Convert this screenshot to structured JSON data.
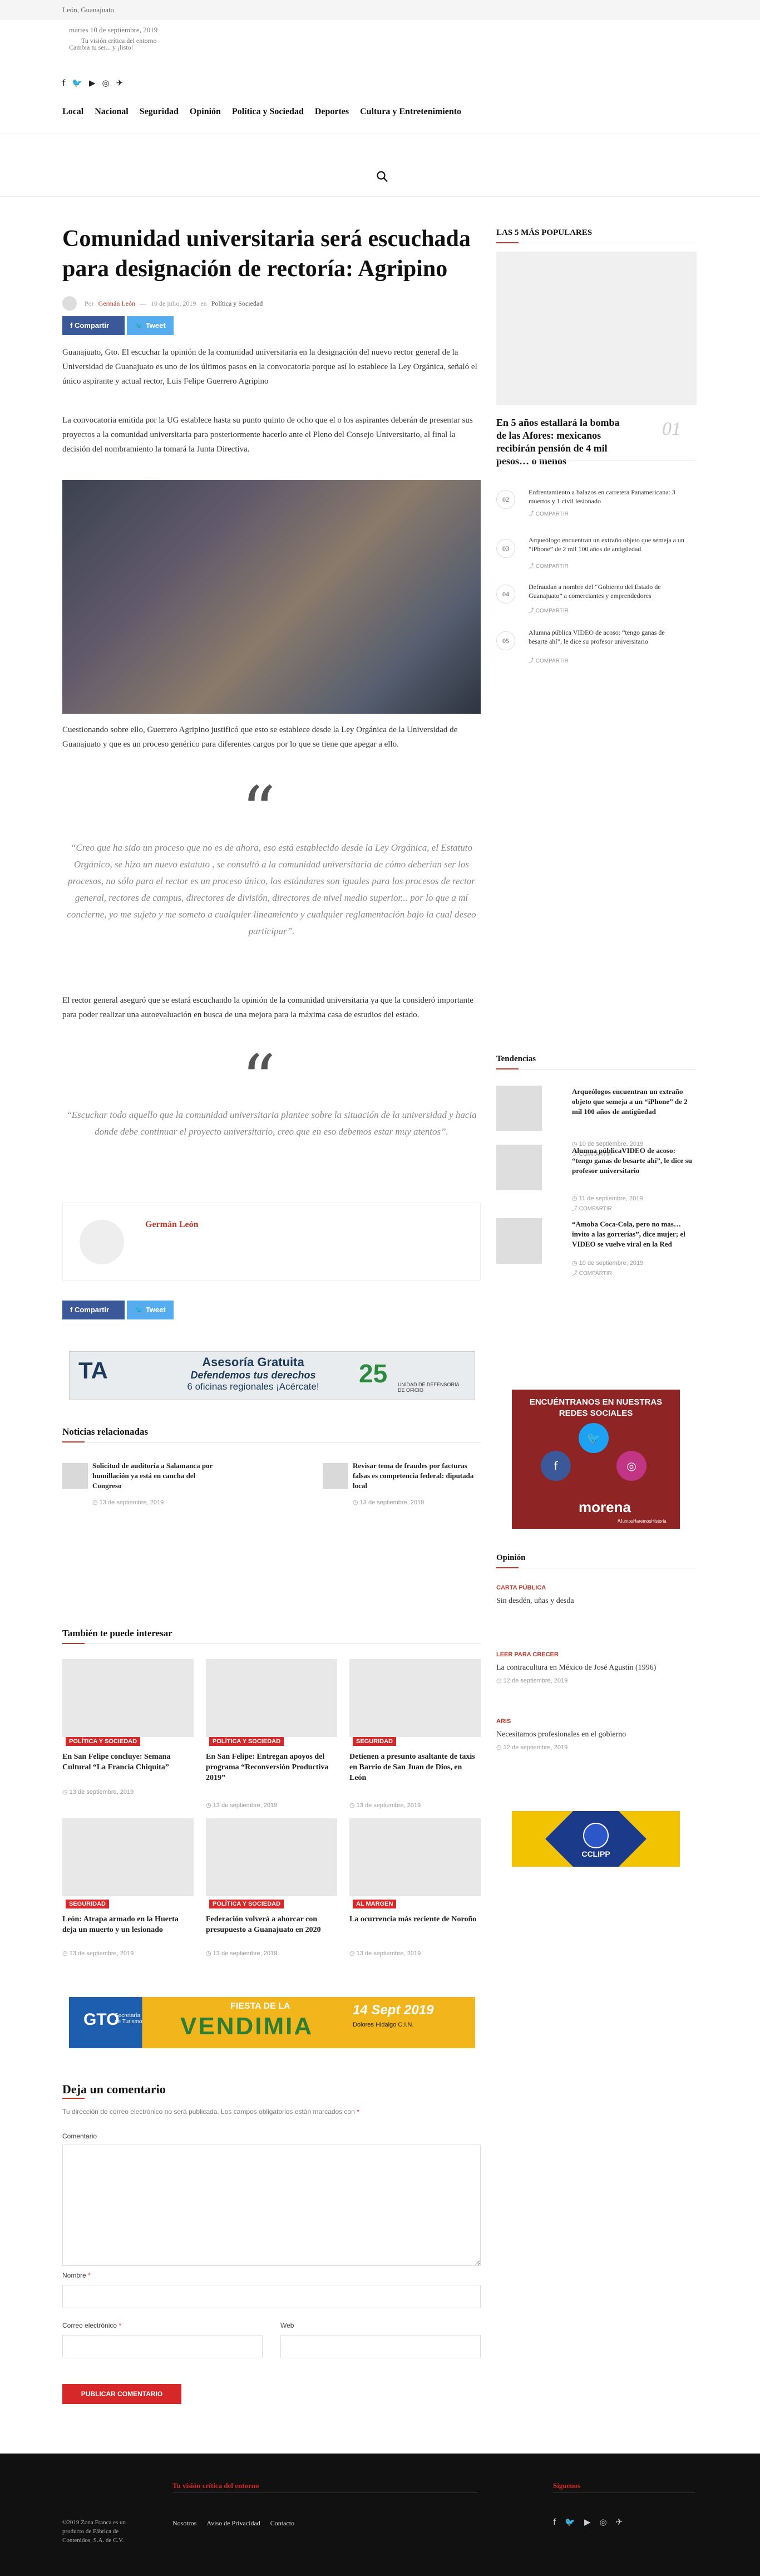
{
  "topbar": {
    "location": "León, Guanajuato"
  },
  "header": {
    "date": "martes 10 de septiembre, 2019",
    "logo_line1": "Tu visión crítica del entorno",
    "logo_line2": "Cambia tu ser... y ¡listo!",
    "social_icons": [
      "facebook-icon",
      "twitter-icon",
      "youtube-icon",
      "instagram-icon",
      "telegram-icon"
    ],
    "nav": [
      "Local",
      "Nacional",
      "Seguridad",
      "Opinión",
      "Política y Sociedad",
      "Deportes",
      "Cultura y Entretenimiento"
    ]
  },
  "article": {
    "title": "Comunidad universitaria será escuchada para designación de rectoría: Agripino",
    "meta": {
      "by": "Por",
      "author": "Germán León",
      "date": "10 de julio, 2019",
      "in": "en",
      "category": "Política y Sociedad"
    },
    "share": {
      "facebook": "Compartir",
      "twitter": "Tweet"
    },
    "p1": "Guanajuato, Gto. El escuchar la opinión de la comunidad universitaria en la designación del nuevo rector general de la Universidad de Guanajuato es uno de los últimos pasos en la convocatoria porque así lo establece la Ley Orgánica, señaló el único aspirante y actual rector, Luis Felipe Guerrero Agripino",
    "p2": "La convocatoria emitida por la UG establece hasta su punto quinto de ocho que el o los aspirantes deberán de presentar sus proyectos a la comunidad universitaria para posteriormente hacerlo ante el Pleno del Consejo Universitario, al final la decisión del nombramiento la tomará la Junta Directiva.",
    "p3": "Cuestionando sobre ello, Guerrero Agripino justificó que esto se establece desde la Ley Orgánica de la Universidad de Guanajuato y que es un proceso genérico para diferentes cargos por lo que se tiene que apegar a ello.",
    "quote1": "“Creo que ha sido un proceso que no es de ahora, eso está establecido desde la Ley Orgánica, el Estatuto Orgánico, se hizo un nuevo estatuto , se consultó a la comunidad universitaria de cómo deberían ser los procesos, no sólo para el rector es un proceso único, los estándares son iguales para los procesos de rector general, rectores de campus, directores de división, directores de nivel medio superior... por lo que a mí concierne, yo me sujeto y me someto a cualquier lineamiento y cualquier reglamentación bajo la cual deseo participar”.",
    "p4": "El rector general aseguró que se estará escuchando la opinión de la comunidad universitaria ya que la consideró importante para poder realizar una autoevaluación en busca de una mejora para la máxima casa de estudios del estado.",
    "quote2": "“Escuchar todo aquello que la comunidad universitaria plantee sobre la situación de la universidad y hacia donde debe continuar el proyecto universitario, creo que en eso debemos estar muy atentos”.",
    "author_box": "Germán León"
  },
  "ad1": {
    "title": "Asesoría Gratuita",
    "line2": "Defendemos tus derechos",
    "line3": "6 oficinas regionales ¡Acércate!",
    "years": "25",
    "unit": "UNIDAD DE DEFENSORÍA DE OFICIO"
  },
  "related": {
    "heading": "Noticias relacionadas",
    "items": [
      {
        "title": "Solicitud de auditoría a Salamanca por humillación ya está en cancha del Congreso",
        "date": "13 de septiembre, 2019"
      },
      {
        "title": "Revisar tema de fraudes por facturas falsas es competencia federal: diputada local",
        "date": "13 de septiembre, 2019"
      }
    ]
  },
  "also": {
    "heading": "También te puede interesar",
    "items": [
      {
        "badge": "POLÍTICA Y SOCIEDAD",
        "title": "En San Felipe concluye: Semana Cultural “La Francia Chiquita”",
        "date": "13 de septiembre, 2019"
      },
      {
        "badge": "POLÍTICA Y SOCIEDAD",
        "title": "En San Felipe: Entregan apoyos del programa “Reconversión Productiva 2019”",
        "date": "13 de septiembre, 2019"
      },
      {
        "badge": "SEGURIDAD",
        "title": "Detienen a presunto asaltante de taxis en Barrio de San Juan de Dios, en León",
        "date": "13 de septiembre, 2019"
      },
      {
        "badge": "SEGURIDAD",
        "title": "León: Atrapa armado en la Huerta deja un muerto y un lesionado",
        "date": "13 de septiembre, 2019"
      },
      {
        "badge": "POLÍTICA Y SOCIEDAD",
        "title": "Federación volverá a ahorcar con presupuesto a Guanajuato en 2020",
        "date": "13 de septiembre, 2019"
      },
      {
        "badge": "AL MARGEN",
        "title": "La ocurrencia más reciente de Noroño",
        "date": "13 de septiembre, 2019"
      }
    ]
  },
  "ad2": {
    "brand": "GTO",
    "sub": "Secretaría de Turismo",
    "event": "FIESTA DE LA",
    "name": "VENDIMIA",
    "date": "14 Sept 2019",
    "place": "Dolores Hidalgo C.I.N."
  },
  "comments": {
    "heading": "Deja un comentario",
    "note": "Tu dirección de correo electrónico no será publicada. Los campos obligatorios están marcados con",
    "req": "*",
    "comment_label": "Comentario",
    "name_label": "Nombre",
    "email_label": "Correo electrónico",
    "web_label": "Web",
    "submit": "PUBLICAR COMENTARIO"
  },
  "sidebar": {
    "popular_heading": "LAS 5 MÁS POPULARES",
    "popular_first": {
      "title": "En 5 años estallará la bomba de las Afores: mexicanos recibirán pensión de 4 mil pesos… o menos",
      "num": "01"
    },
    "popular": [
      {
        "num": "02",
        "title": "Enfrentamiento a balazos en carretera Panamericana: 3 muertos y 1 civil lesionado",
        "share": "COMPARTIR"
      },
      {
        "num": "03",
        "title": "Arqueólogo encuentran un extraño objeto que semeja a un “iPhone” de 2 mil 100 años de antigüedad",
        "share": "COMPARTIR"
      },
      {
        "num": "04",
        "title": "Defraudan a nombre del “Gobierno del Estado de Guanajuato” a comerciantes y emprendedores",
        "share": "COMPARTIR"
      },
      {
        "num": "05",
        "title": "Alumna pública VIDEO de acoso: “tengo ganas de besarte ahí”, le dice su profesor universitario",
        "share": "COMPARTIR"
      }
    ],
    "trends_heading": "Tendencias",
    "trends": [
      {
        "title": "Arqueólogos encuentran un extraño objeto que semeja a un “iPhone” de 2 mil 100 años de antigüedad",
        "date": "10 de septiembre, 2019",
        "share": "COMPARTIR"
      },
      {
        "title": "Alumna públicaVIDEO de acoso: “tengo ganas de besarte ahí”, le dice su profesor universitario",
        "date": "11 de septiembre, 2019",
        "share": "COMPARTIR"
      },
      {
        "title": "“Amoba Coca-Cola, pero no mas… invito a las gorrerías”, dice mujer; el VIDEO se vuelve viral en la Red",
        "date": "10 de septiembre, 2019",
        "share": "COMPARTIR"
      }
    ],
    "social_banner": {
      "line1": "ENCUÉNTRANOS EN NUESTRAS",
      "line2": "REDES SOCIALES",
      "brand": "morena",
      "tag": "#JuntosHaremosHistoria"
    },
    "opinion_heading": "Opinión",
    "opinion": [
      {
        "cat": "CARTA PÚBLICA",
        "title": "Sin desdén, uñas y desda",
        "date": ""
      },
      {
        "cat": "LEER PARA CRECER",
        "title": "La contracultura en México de José Agustín (1996)",
        "date": "12 de septiembre, 2019"
      },
      {
        "cat": "ARIS",
        "title": "Necesitamos profesionales en el gobierno",
        "date": "12 de septiembre, 2019"
      }
    ],
    "cclipp": "CCLIPP"
  },
  "footer": {
    "tagline": "Tu visión crítica del entorno",
    "follow": "Síguenos",
    "copyright": "©2019 Zona Franca es un producto de Fábrica de Contenidos, S.A. de C.V.",
    "links": [
      "Nosotros",
      "Aviso de Privacidad",
      "Contacto"
    ]
  }
}
